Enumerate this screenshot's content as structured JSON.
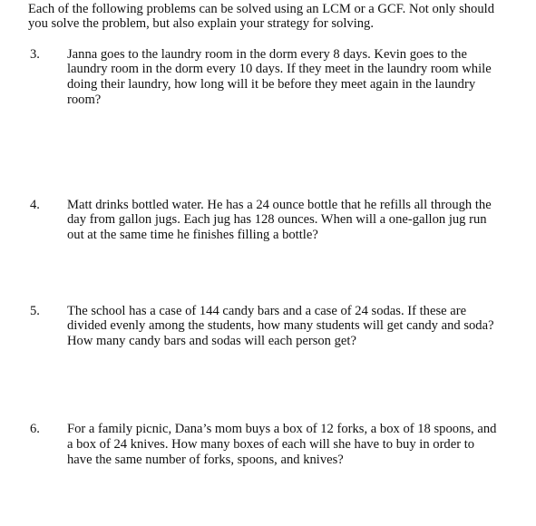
{
  "instructions": {
    "lines": [
      "Each of the following problems can be solved using an LCM or a GCF.  Not only should",
      "you solve the problem, but also explain your strategy for solving."
    ]
  },
  "problems": [
    {
      "number": "3.",
      "lines": [
        "Janna goes to the laundry room in the dorm every 8 days.  Kevin goes to the",
        "laundry room in the dorm every 10 days.  If they meet in the laundry room while",
        "doing their laundry, how long will it be before they meet again in the laundry",
        "room?"
      ]
    },
    {
      "number": "4.",
      "lines": [
        "Matt drinks bottled water.  He has a 24 ounce bottle that he refills all through the",
        "day from gallon jugs.  Each jug has 128 ounces.  When will a one-gallon jug run",
        "out at the same time he finishes filling a bottle?"
      ]
    },
    {
      "number": "5.",
      "lines": [
        "The school has a case of 144 candy bars and a case of 24 sodas.  If these are",
        "divided evenly among the students, how many students will get candy and soda?",
        "How many candy bars and sodas will each person get?"
      ]
    },
    {
      "number": "6.",
      "lines": [
        "For a family picnic, Dana’s mom buys a box of 12 forks, a box of 18 spoons, and",
        "a box of 24 knives.  How many boxes of each will she have to buy in order to",
        "have the same number of forks, spoons, and knives?"
      ]
    }
  ]
}
